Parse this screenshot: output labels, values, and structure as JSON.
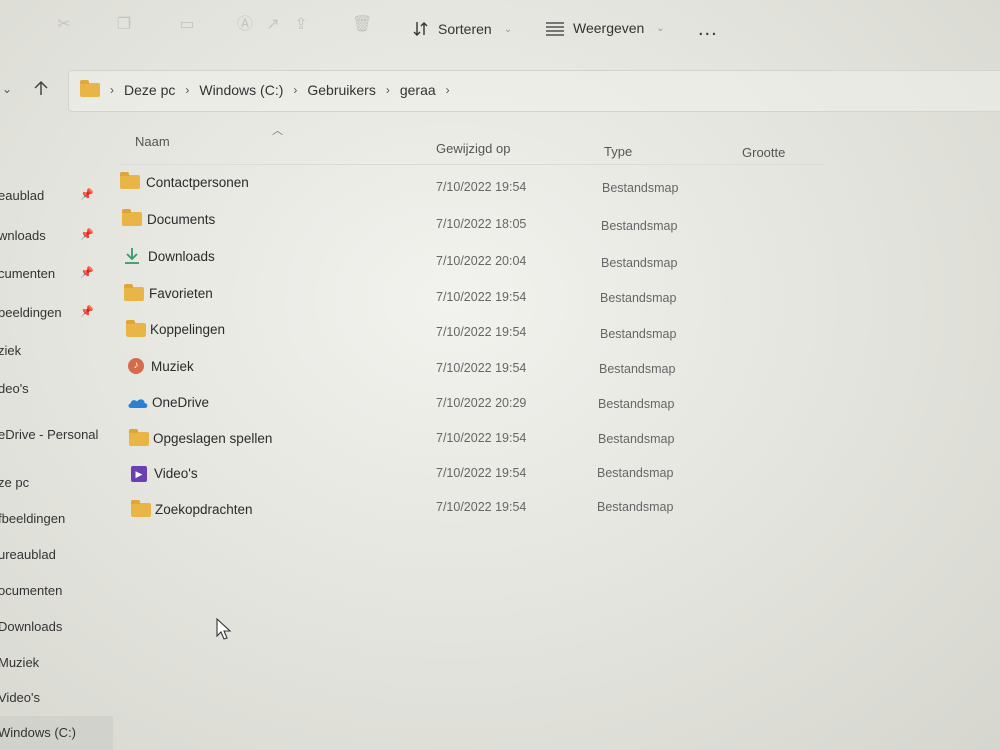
{
  "toolbar": {
    "sort_label": "Sorteren",
    "view_label": "Weergeven",
    "more_label": "..."
  },
  "breadcrumb": [
    "Deze pc",
    "Windows (C:)",
    "Gebruikers",
    "geraa"
  ],
  "columns": {
    "name": "Naam",
    "modified": "Gewijzigd op",
    "type": "Type",
    "size": "Grootte"
  },
  "sidebar": {
    "items": [
      "eaublad",
      "wnloads",
      "cumenten",
      "beeldingen",
      "ziek",
      "deo's",
      "eDrive - Personal",
      "ze pc",
      "fbeeldingen",
      "ureaublad",
      "ocumenten",
      "Downloads",
      "Muziek",
      "Video's",
      "Windows (C:)"
    ]
  },
  "files": [
    {
      "name": "Contactpersonen",
      "modified": "7/10/2022 19:54",
      "type": "Bestandsmap",
      "icon": "folder-icon"
    },
    {
      "name": "Documents",
      "modified": "7/10/2022 18:05",
      "type": "Bestandsmap",
      "icon": "folder-icon"
    },
    {
      "name": "Downloads",
      "modified": "7/10/2022 20:04",
      "type": "Bestandsmap",
      "icon": "download-icon"
    },
    {
      "name": "Favorieten",
      "modified": "7/10/2022 19:54",
      "type": "Bestandsmap",
      "icon": "folder-icon"
    },
    {
      "name": "Koppelingen",
      "modified": "7/10/2022 19:54",
      "type": "Bestandsmap",
      "icon": "folder-icon"
    },
    {
      "name": "Muziek",
      "modified": "7/10/2022 19:54",
      "type": "Bestandsmap",
      "icon": "music-icon"
    },
    {
      "name": "OneDrive",
      "modified": "7/10/2022 20:29",
      "type": "Bestandsmap",
      "icon": "onedrive-icon"
    },
    {
      "name": "Opgeslagen spellen",
      "modified": "7/10/2022 19:54",
      "type": "Bestandsmap",
      "icon": "folder-icon"
    },
    {
      "name": "Video's",
      "modified": "7/10/2022 19:54",
      "type": "Bestandsmap",
      "icon": "video-icon"
    },
    {
      "name": "Zoekopdrachten",
      "modified": "7/10/2022 19:54",
      "type": "Bestandsmap",
      "icon": "folder-icon"
    }
  ],
  "colors": {
    "folder": "#e9b546",
    "download_arrow": "#3a9a6a",
    "music": "#d46b4b",
    "onedrive": "#2b7fd4",
    "video": "#6a3fb3"
  }
}
